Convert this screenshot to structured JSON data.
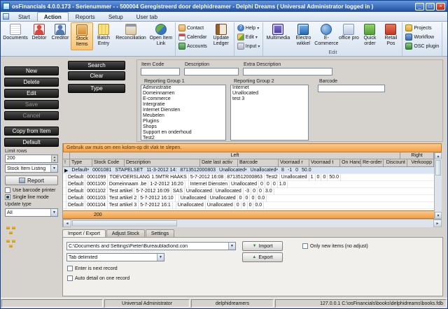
{
  "colors": {
    "titlebar_start": "#6498e0",
    "titlebar_end": "#1e4c9c",
    "drag_bar": "#f2a044",
    "drag_bar_light": "#fbc98c",
    "selected_row": "#d7e5f5",
    "dark_button": "#161616"
  },
  "window": {
    "title": "osFinancials 4.0.0.173 - Serienummer - - 500004 Geregistreerd door delphidreamer - Delphi Dreams ( Universal Administrator logged in )"
  },
  "tabs": {
    "start": "Start",
    "action": "Action",
    "reports": "Reports",
    "setup": "Setup",
    "usertab": "User tab"
  },
  "ribbon": {
    "buttons": {
      "documents": "Documents",
      "debtor": "Debtor",
      "creditor": "Creditor",
      "stock_items": "Stock Items",
      "batch_entry": "Batch Entry",
      "reconciliation": "Reconciliation",
      "open_item_link": "Open Item Link",
      "contact": "Contact",
      "calendar": "Calendar",
      "accounts": "Accounts",
      "update_ledger": "Update Ledger",
      "help": "Help",
      "edit": "Edit",
      "input": "Input",
      "multimedia": "Multimedia",
      "electro_wikkel": "Electro wikkel",
      "ecommerce": "E-Commerce",
      "office_pro": "office pro",
      "quick_order": "Quick order",
      "retail_pos": "Retail Pos",
      "projects": "Projects",
      "workflow": "Workflow",
      "osc_plugin": "OSC plugin"
    },
    "group_label_edit": "Edit"
  },
  "sidebar": {
    "buttons": {
      "new": "New",
      "delete": "Delete",
      "edit": "Edit",
      "save": "Save",
      "cancel": "Cancel",
      "copy_from_item": "Copy from Item",
      "default": "Default"
    },
    "limit_rows_label": "Limit rows",
    "limit_rows_value": "200",
    "listing_value": "Stock Item Listing",
    "report_label": "Report",
    "use_barcode_printer": "Use barcode printer",
    "single_line_mode": "Single line mode",
    "update_type_label": "Update type",
    "update_type_value": "All"
  },
  "search": {
    "buttons": {
      "search": "Search",
      "clear": "Clear",
      "type": "Type"
    },
    "item_code_label": "Item Code",
    "description_label": "Description",
    "extra_description_label": "Extra Description",
    "barcode_label": "Barcode",
    "reporting_group1_label": "Reporting Group 1",
    "reporting_group2_label": "Reporting Group 2",
    "reporting_group1_items": [
      "Administratie",
      "Domeinnamen",
      "E-commerce",
      "Intergratie",
      "Internet Diensten",
      "Meubelen",
      "Plugins",
      "Shops",
      "Support en onderhoud",
      "Test2"
    ],
    "reporting_group2_items": [
      "Internet",
      "Unallocated",
      "test 3"
    ]
  },
  "grid": {
    "drag_hint": "Gebruik uw muis om een kolom-op dit vlak te slepen.",
    "band_left": "Left",
    "band_right": "Right",
    "columns": [
      "!",
      "Type",
      "Stock Code",
      "Description",
      "Date last activ",
      "Barcode",
      "Voorraad r",
      "Voorraad t",
      "On Hand",
      "Re-order",
      "Discount",
      "Verkoopp"
    ],
    "rows": [
      [
        "▶",
        "Default",
        "0001081",
        "STAPELSET",
        "11-3-2012 14:",
        "8713512000803",
        "Unallocated",
        "Unallocated",
        "8",
        "-1",
        "0",
        "50.0"
      ],
      [
        "",
        "Default",
        "0001099",
        "TOEVOERSLANG 1.5MTR HAAKS",
        "5-7-2012 16:08",
        "8713512000863",
        "Test2",
        "Unallocated",
        "1",
        "0",
        "0",
        "50.0"
      ],
      [
        "",
        "Default",
        "0001100",
        "Domeinnaam .be",
        "1-2-2012 16:20",
        "",
        "Internet Diensten",
        "Unallocated",
        "0",
        "0",
        "0",
        "1.0"
      ],
      [
        "",
        "Default",
        "0001102",
        "Test artikel",
        "5-7-2012 16:09",
        "SAS",
        "Unallocated",
        "Unallocated",
        "-3",
        "0",
        "0",
        "3.0"
      ],
      [
        "",
        "Default",
        "0001103",
        "Test artikel 2",
        "5-7-2012 16:10",
        "",
        "Unallocated",
        "Unallocated",
        "0",
        "0",
        "0",
        "0.0"
      ],
      [
        "",
        "Default",
        "0001104",
        "Test artikel 3",
        "5-7-2012 16:1",
        "",
        "Unallocated",
        "Unallocated",
        "0",
        "0",
        "0",
        "0.0"
      ]
    ],
    "footer_count": "200"
  },
  "bottom": {
    "tabs": [
      "Import / Export",
      "Adjust Stock",
      "Settings"
    ],
    "file_path": "C:\\Documents and Settings\\Pieter\\Bureaublad\\ond.con",
    "import_label": "Import",
    "export_label": "Export",
    "only_new_label": "Only new items (no adjust)",
    "format_value": "Tab delimited",
    "enter_next_label": "Enter is next record",
    "auto_detail_label": "Auto detail on one record"
  },
  "status": {
    "user": "Universal Administrator",
    "company": "delphidreamers",
    "connection": "127.0.0.1 C:\\osFinancials\\books\\delphidreams\\books.fdb"
  }
}
